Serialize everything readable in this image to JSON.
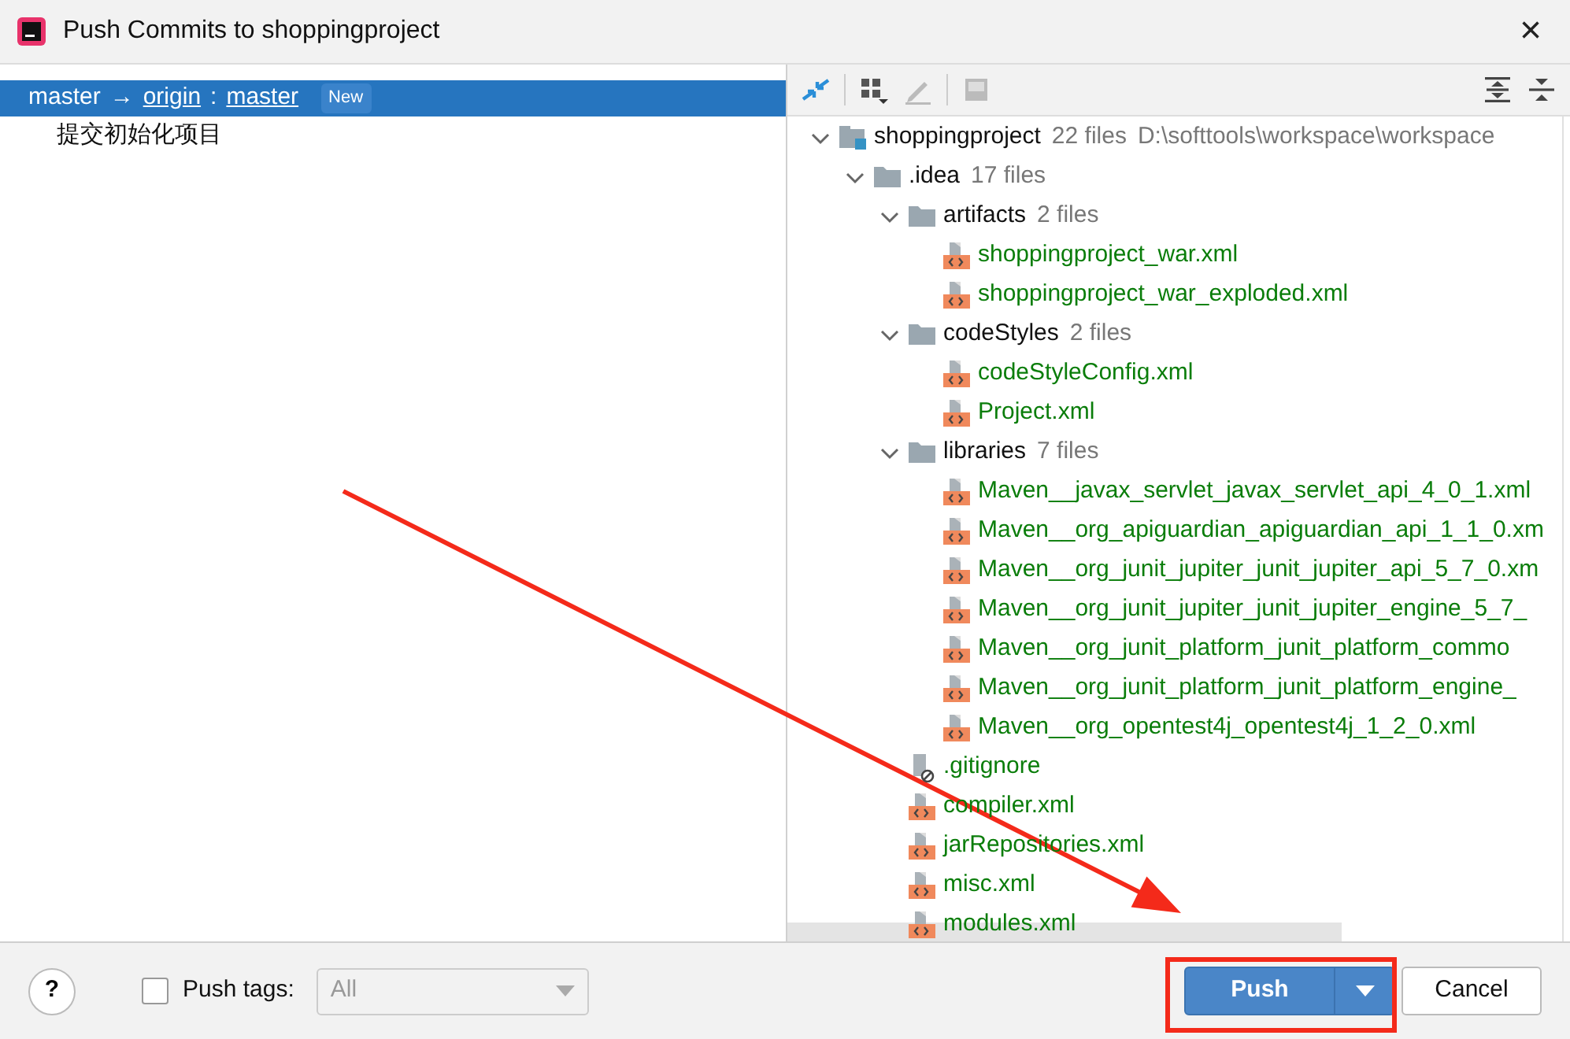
{
  "window": {
    "title": "Push Commits to shoppingproject",
    "close": "×"
  },
  "push_targets": [
    {
      "local_branch": "master",
      "arrow": "→",
      "remote": "origin",
      "separator": ":",
      "remote_branch": "master",
      "badge": "New",
      "selected": true,
      "commits": [
        "提交初始化项目"
      ]
    }
  ],
  "file_tree": {
    "name": "shoppingproject",
    "kind": "module",
    "count": "22 files",
    "path": "D:\\softtools\\workspace\\workspace",
    "expanded": true,
    "children": [
      {
        "name": ".idea",
        "kind": "folder",
        "count": "17 files",
        "expanded": true,
        "children": [
          {
            "name": "artifacts",
            "kind": "folder",
            "count": "2 files",
            "expanded": true,
            "children": [
              {
                "name": "shoppingproject_war.xml",
                "kind": "xml",
                "added": true
              },
              {
                "name": "shoppingproject_war_exploded.xml",
                "kind": "xml",
                "added": true
              }
            ]
          },
          {
            "name": "codeStyles",
            "kind": "folder",
            "count": "2 files",
            "expanded": true,
            "children": [
              {
                "name": "codeStyleConfig.xml",
                "kind": "xml",
                "added": true
              },
              {
                "name": "Project.xml",
                "kind": "xml",
                "added": true
              }
            ]
          },
          {
            "name": "libraries",
            "kind": "folder",
            "count": "7 files",
            "expanded": true,
            "children": [
              {
                "name": "Maven__javax_servlet_javax_servlet_api_4_0_1.xml",
                "kind": "xml",
                "added": true
              },
              {
                "name": "Maven__org_apiguardian_apiguardian_api_1_1_0.xm",
                "kind": "xml",
                "added": true
              },
              {
                "name": "Maven__org_junit_jupiter_junit_jupiter_api_5_7_0.xm",
                "kind": "xml",
                "added": true
              },
              {
                "name": "Maven__org_junit_jupiter_junit_jupiter_engine_5_7_",
                "kind": "xml",
                "added": true
              },
              {
                "name": "Maven__org_junit_platform_junit_platform_commo",
                "kind": "xml",
                "added": true
              },
              {
                "name": "Maven__org_junit_platform_junit_platform_engine_",
                "kind": "xml",
                "added": true
              },
              {
                "name": "Maven__org_opentest4j_opentest4j_1_2_0.xml",
                "kind": "xml",
                "added": true
              }
            ]
          },
          {
            "name": ".gitignore",
            "kind": "ignore",
            "added": true
          },
          {
            "name": "compiler.xml",
            "kind": "xml",
            "added": true
          },
          {
            "name": "jarRepositories.xml",
            "kind": "xml",
            "added": true
          },
          {
            "name": "misc.xml",
            "kind": "xml",
            "added": true
          },
          {
            "name": "modules.xml",
            "kind": "xml",
            "added": true
          }
        ]
      }
    ]
  },
  "footer": {
    "help": "?",
    "push_tags": {
      "label": "Push tags:",
      "checked": false
    },
    "tags_dropdown": {
      "value": "All",
      "disabled": true
    },
    "buttons": [
      {
        "label": "Push",
        "kind": "primary"
      },
      {
        "label": "Cancel",
        "kind": "secondary"
      }
    ]
  }
}
